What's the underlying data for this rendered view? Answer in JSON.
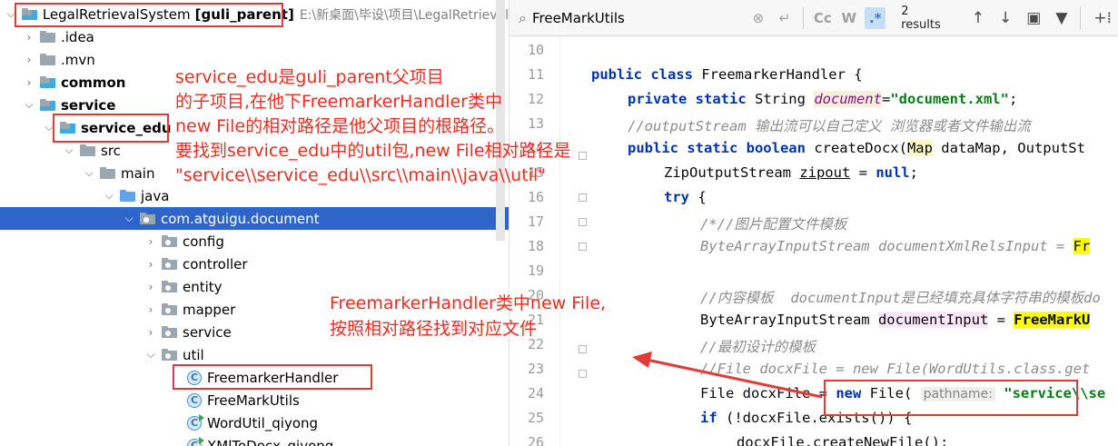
{
  "tree": {
    "items": [
      {
        "label": "LegalRetrievalSystem",
        "bold_label": "[guli_parent]",
        "path": "E:\\新桌面\\毕设\\项目\\LegalRetrieval"
      },
      {
        "label": ".idea"
      },
      {
        "label": ".mvn"
      },
      {
        "label": "common"
      },
      {
        "label": "service"
      },
      {
        "label": "service_edu"
      },
      {
        "label": "src"
      },
      {
        "label": "main"
      },
      {
        "label": "java"
      },
      {
        "label": "com.atguigu.document"
      },
      {
        "label": "config"
      },
      {
        "label": "controller"
      },
      {
        "label": "entity"
      },
      {
        "label": "mapper"
      },
      {
        "label": "service"
      },
      {
        "label": "util"
      },
      {
        "label": "FreemarkerHandler"
      },
      {
        "label": "FreeMarkUtils"
      },
      {
        "label": "WordUtil_qiyong"
      },
      {
        "label": "XMlToDocx_qiyong"
      }
    ],
    "class_letter": "C"
  },
  "findbar": {
    "query": "FreeMarkUtils",
    "match_case": "Cc",
    "words": "W",
    "regex": ".*",
    "results": "2 results"
  },
  "editor": {
    "line_numbers": [
      "10",
      "11",
      "12",
      "13",
      "14",
      "15",
      "16",
      "17",
      "18",
      "19",
      "20",
      "21",
      "22",
      "23",
      "24",
      "25",
      "26"
    ],
    "lines": {
      "l11_a": "public class ",
      "l11_b": "FreemarkerHandler {",
      "l12_a": "private static ",
      "l12_b": "String ",
      "l12_c": "document",
      "l12_d": "=",
      "l12_e": "\"document.xml\"",
      "l12_f": ";",
      "l13": "//outputStream 输出流可以自己定义 浏览器或者文件输出流",
      "l14_a": "public static boolean ",
      "l14_b": "createDocx(",
      "l14_c": "Map",
      "l14_d": " dataMap, OutputSt",
      "l15_a": "ZipOutputStream ",
      "l15_b": "zipout",
      "l15_c": " = ",
      "l15_d": "null",
      "l15_e": ";",
      "l16_a": "try",
      "l16_b": " {",
      "l17": "/*//图片配置文件模板",
      "l18_a": "ByteArrayInputStream documentXmlRelsInput = ",
      "l18_b": "Fr",
      "l20": "//内容模板  documentInput是已经填充具体字符串的模板do",
      "l21_a": "ByteArrayInputStream ",
      "l21_b": "documentInput",
      "l21_c": " = ",
      "l21_d": "FreeMarkU",
      "l22": "//最初设计的模板",
      "l23": "//File docxFile = new File(WordUtils.class.get",
      "l24_a": "File docxFile = ",
      "l24_b": "new ",
      "l24_c": "File(",
      "l24_d": "pathname:",
      "l24_e": " \"service\\\\se",
      "l25_a": "if ",
      "l25_b": "(!docxFile.exists()) {",
      "l26": "docxFile.createNewFile();"
    }
  },
  "annotations": {
    "main": [
      "service_edu是guli_parent父项目",
      "的子项目,在他下FreemarkerHandler类中",
      "new File的相对路径是他父项目的根路径。",
      "要找到service_edu中的util包,new File相对路径是",
      "\"service\\\\service_edu\\\\src\\\\main\\\\java\\\\util\""
    ],
    "second": [
      "FreemarkerHandler类中new File,",
      "按照相对路径找到对应文件"
    ],
    "color": "#f42a1f"
  },
  "colors": {
    "selection": "#2f65ca",
    "keyword": "#0033b3",
    "string": "#067d17",
    "comment": "#8c8c8c",
    "annotation_red": "#e53935"
  }
}
